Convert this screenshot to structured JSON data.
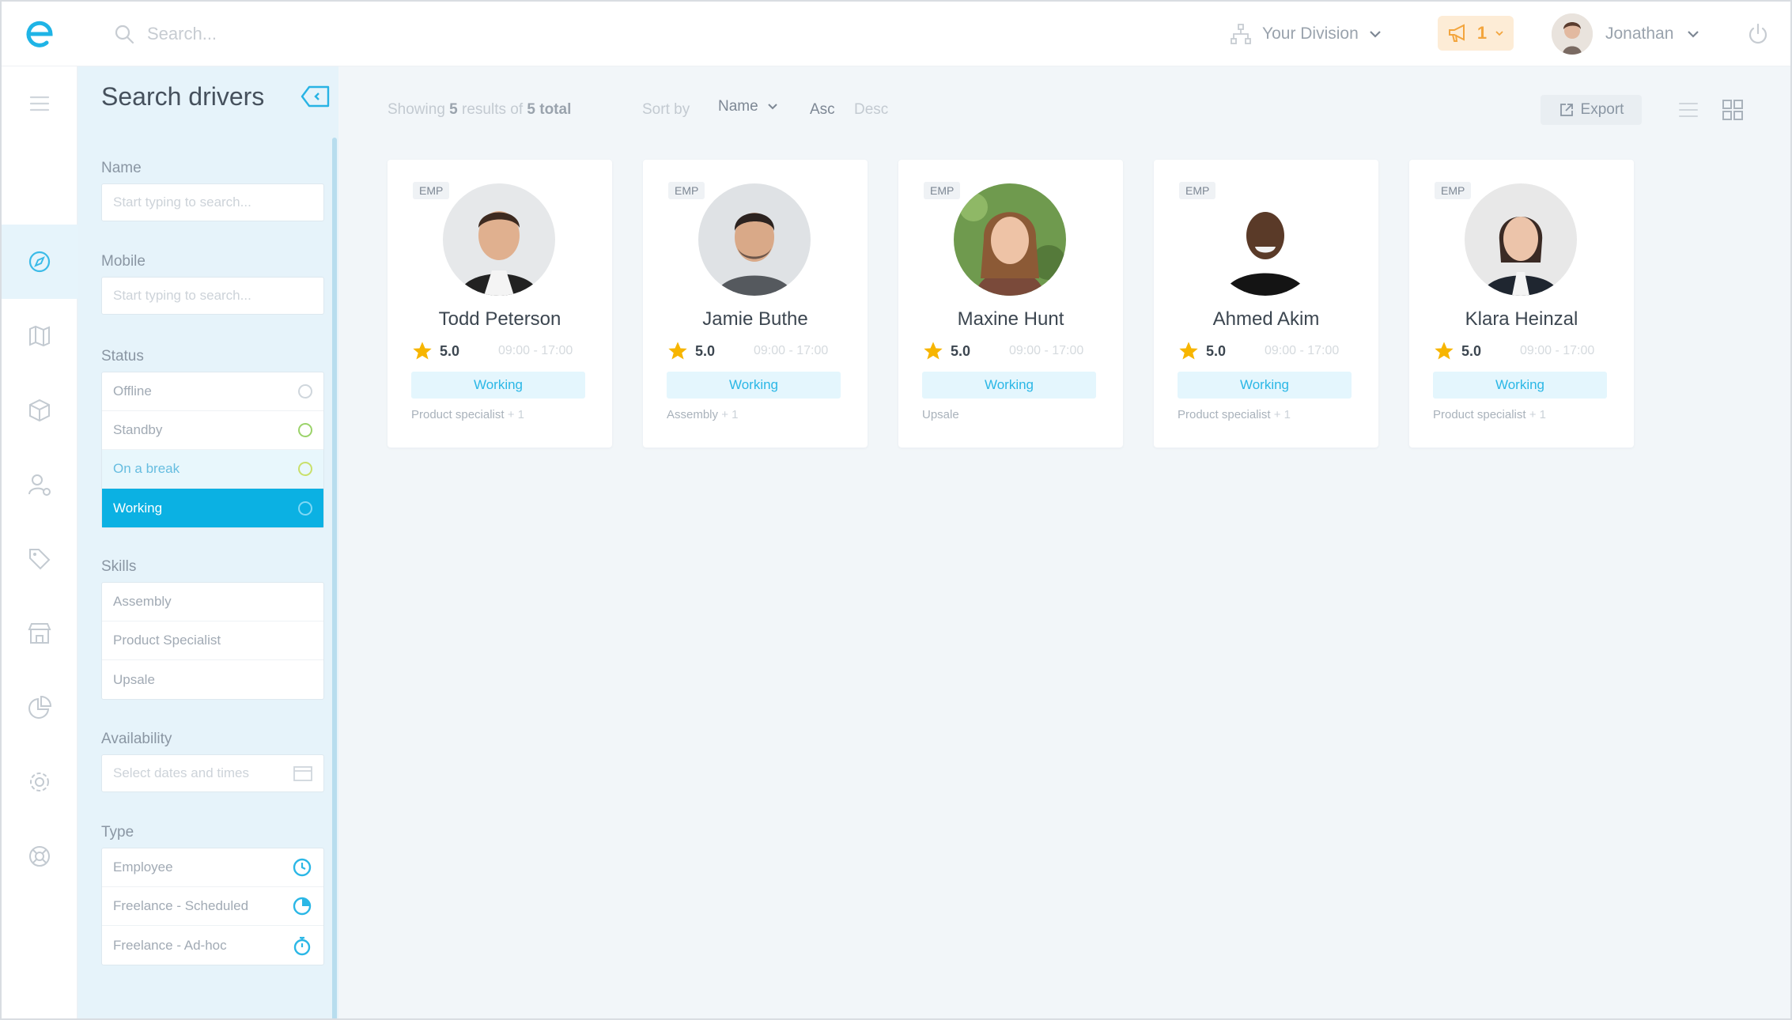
{
  "topbar": {
    "search_placeholder": "Search...",
    "division_label": "Your Division",
    "alerts_count": "1",
    "user_name": "Jonathan"
  },
  "filters": {
    "title": "Search drivers",
    "name_label": "Name",
    "name_placeholder": "Start typing to search...",
    "mobile_label": "Mobile",
    "mobile_placeholder": "Start typing to search...",
    "status_label": "Status",
    "status_options": [
      {
        "label": "Offline",
        "ring_color": "#cfd6dc"
      },
      {
        "label": "Standby",
        "ring_color": "#9bd36a"
      },
      {
        "label": "On a break",
        "ring_color": "#c9e06a"
      },
      {
        "label": "Working",
        "ring_color": "#7fd8f5"
      }
    ],
    "skills_label": "Skills",
    "skills_options": [
      "Assembly",
      "Product Specialist",
      "Upsale"
    ],
    "availability_label": "Availability",
    "availability_placeholder": "Select dates and times",
    "type_label": "Type",
    "type_options": [
      "Employee",
      "Freelance - Scheduled",
      "Freelance - Ad-hoc"
    ]
  },
  "toolbar": {
    "showing_prefix": "Showing",
    "showing_count": "5",
    "showing_mid": "results of",
    "total_count": "5 total",
    "sort_label": "Sort by",
    "sort_value": "Name",
    "asc_label": "Asc",
    "desc_label": "Desc",
    "export_label": "Export"
  },
  "drivers": [
    {
      "badge": "EMP",
      "name": "Todd Peterson",
      "rating": "5.0",
      "shift": "09:00 - 17:00",
      "status": "Working",
      "skills": "Product specialist",
      "more": "+ 1"
    },
    {
      "badge": "EMP",
      "name": "Jamie Buthe",
      "rating": "5.0",
      "shift": "09:00 - 17:00",
      "status": "Working",
      "skills": "Assembly",
      "more": "+ 1"
    },
    {
      "badge": "EMP",
      "name": "Maxine Hunt",
      "rating": "5.0",
      "shift": "09:00 - 17:00",
      "status": "Working",
      "skills": "Upsale",
      "more": ""
    },
    {
      "badge": "EMP",
      "name": "Ahmed Akim",
      "rating": "5.0",
      "shift": "09:00 - 17:00",
      "status": "Working",
      "skills": "Product specialist",
      "more": "+ 1"
    },
    {
      "badge": "EMP",
      "name": "Klara Heinzal",
      "rating": "5.0",
      "shift": "09:00 - 17:00",
      "status": "Working",
      "skills": "Product specialist",
      "more": "+ 1"
    }
  ],
  "colors": {
    "accent": "#0bb1e3",
    "star": "#f7b500",
    "alert": "#f3a53d"
  }
}
